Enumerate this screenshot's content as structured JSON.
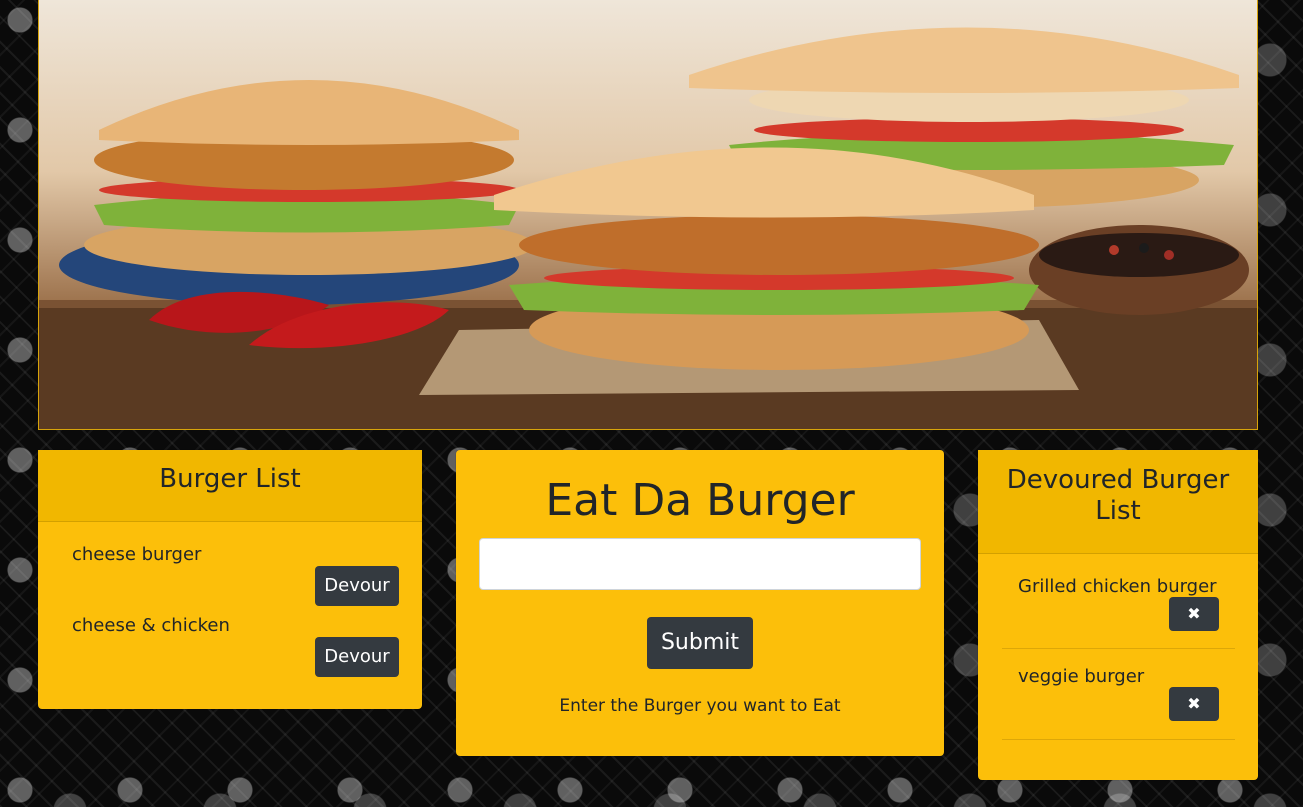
{
  "hero": {
    "image_label": "burgers-photo"
  },
  "burger_list": {
    "title": "Burger List",
    "items": [
      {
        "name": "cheese burger",
        "button_label": "Devour"
      },
      {
        "name": "cheese & chicken",
        "button_label": "Devour"
      }
    ]
  },
  "eat": {
    "title": "Eat Da Burger",
    "input_value": "",
    "input_placeholder": "",
    "submit_label": "Submit",
    "hint": "Enter the Burger you want to Eat"
  },
  "devoured": {
    "title": "Devoured Burger List",
    "items": [
      {
        "name": "Grilled chicken burger",
        "button_icon": "✖"
      },
      {
        "name": "veggie burger",
        "button_icon": "✖"
      }
    ]
  },
  "colors": {
    "card_background": "#fcbf0a",
    "button_dark": "#343a40"
  }
}
